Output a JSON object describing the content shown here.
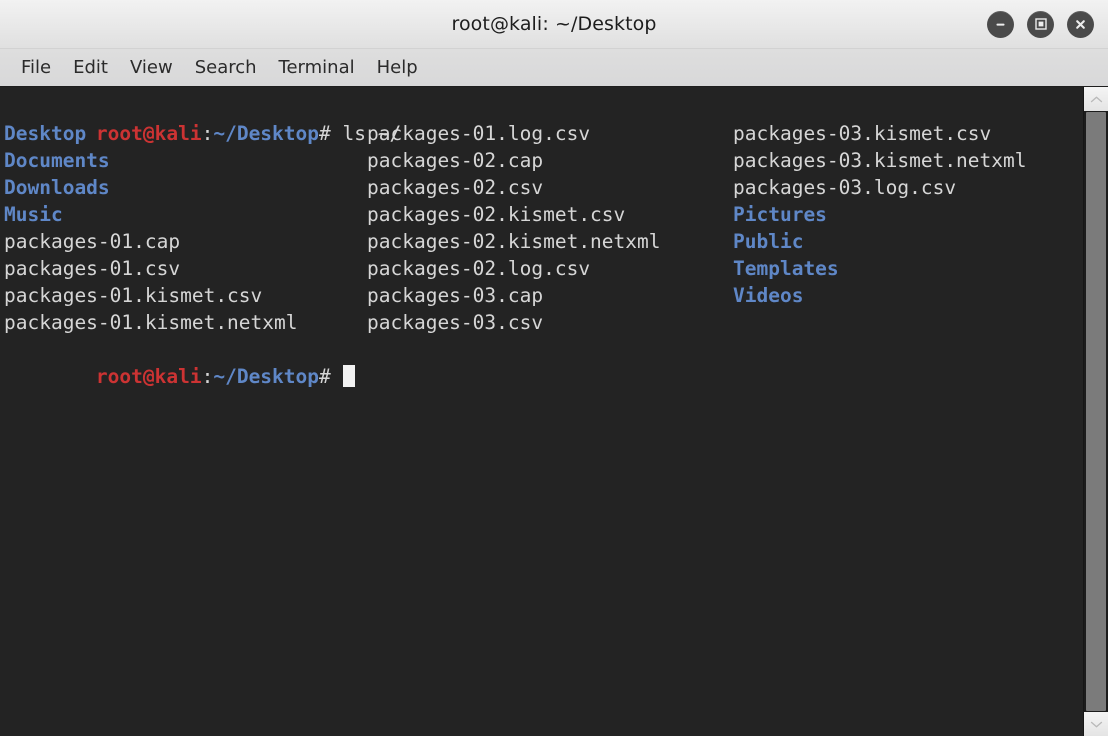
{
  "window": {
    "title": "root@kali: ~/Desktop",
    "controls": [
      {
        "name": "minimize",
        "glyph": "minus"
      },
      {
        "name": "maximize",
        "glyph": "square"
      },
      {
        "name": "close",
        "glyph": "x"
      }
    ]
  },
  "menubar": {
    "items": [
      {
        "label": "File"
      },
      {
        "label": "Edit"
      },
      {
        "label": "View"
      },
      {
        "label": "Search"
      },
      {
        "label": "Terminal"
      },
      {
        "label": "Help"
      }
    ]
  },
  "terminal": {
    "colors": {
      "background": "#232323",
      "foreground": "#d6d6d6",
      "directory_blue": "#5f87c7",
      "prompt_red": "#cc3333",
      "cursor": "#f2f2f2"
    },
    "prompt": {
      "user_host": "root@kali",
      "separator": ":",
      "path": "~/Desktop",
      "sigil": "#"
    },
    "command_line": {
      "command": " ls ~/"
    },
    "listing": {
      "column1": [
        {
          "name": "Desktop",
          "type": "dir"
        },
        {
          "name": "Documents",
          "type": "dir"
        },
        {
          "name": "Downloads",
          "type": "dir"
        },
        {
          "name": "Music",
          "type": "dir"
        },
        {
          "name": "packages-01.cap",
          "type": "file"
        },
        {
          "name": "packages-01.csv",
          "type": "file"
        },
        {
          "name": "packages-01.kismet.csv",
          "type": "file"
        },
        {
          "name": "packages-01.kismet.netxml",
          "type": "file"
        }
      ],
      "column2": [
        {
          "name": "packages-01.log.csv",
          "type": "file"
        },
        {
          "name": "packages-02.cap",
          "type": "file"
        },
        {
          "name": "packages-02.csv",
          "type": "file"
        },
        {
          "name": "packages-02.kismet.csv",
          "type": "file"
        },
        {
          "name": "packages-02.kismet.netxml",
          "type": "file"
        },
        {
          "name": "packages-02.log.csv",
          "type": "file"
        },
        {
          "name": "packages-03.cap",
          "type": "file"
        },
        {
          "name": "packages-03.csv",
          "type": "file"
        }
      ],
      "column3": [
        {
          "name": "packages-03.kismet.csv",
          "type": "file"
        },
        {
          "name": "packages-03.kismet.netxml",
          "type": "file"
        },
        {
          "name": "packages-03.log.csv",
          "type": "file"
        },
        {
          "name": "Pictures",
          "type": "dir"
        },
        {
          "name": "Public",
          "type": "dir"
        },
        {
          "name": "Templates",
          "type": "dir"
        },
        {
          "name": "Videos",
          "type": "dir"
        }
      ]
    }
  },
  "scrollbar": {
    "up_arrow": "scroll-up",
    "down_arrow": "scroll-down"
  }
}
